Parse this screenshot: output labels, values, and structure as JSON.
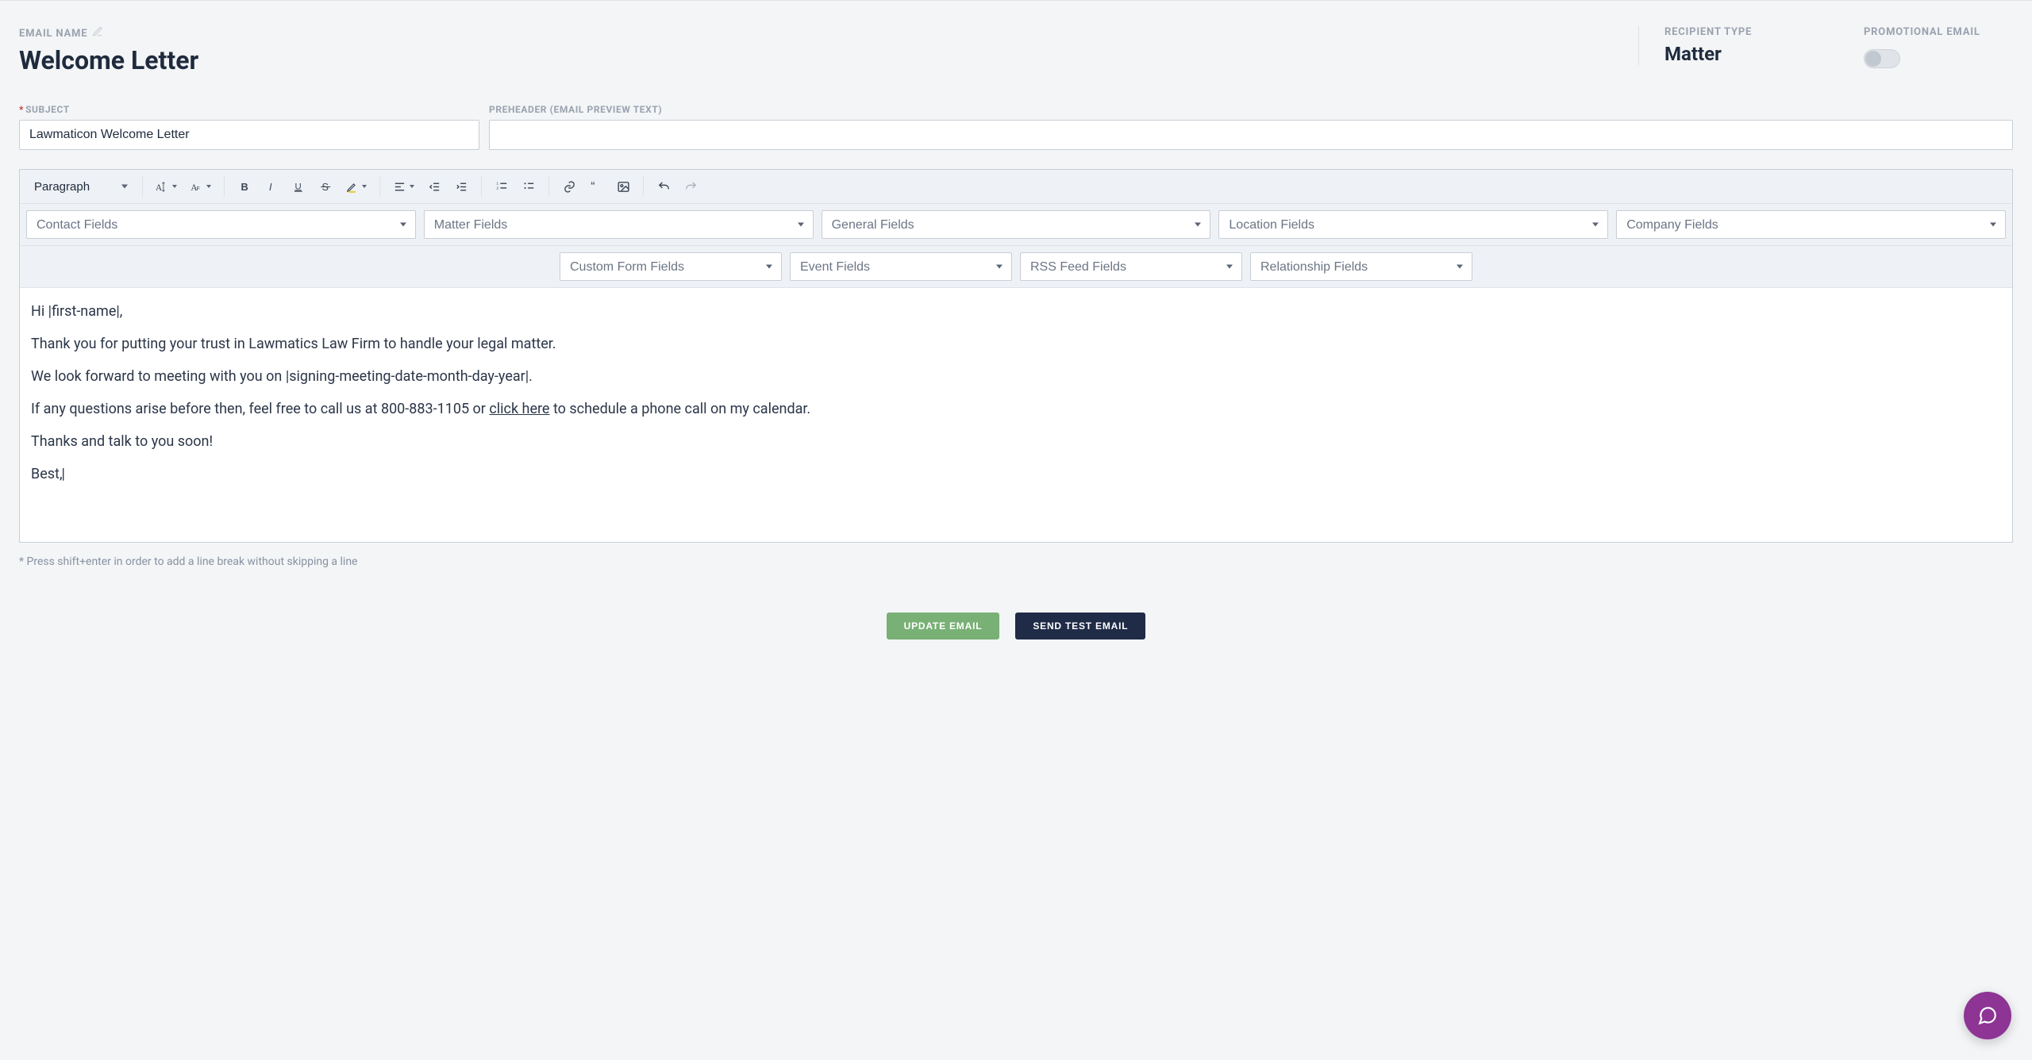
{
  "header": {
    "email_name_label": "EMAIL NAME",
    "title": "Welcome Letter",
    "recipient_type_label": "RECIPIENT TYPE",
    "recipient_type_value": "Matter",
    "promo_label": "PROMOTIONAL EMAIL",
    "promo_on": false
  },
  "form": {
    "subject_label": "SUBJECT",
    "subject_value": "Lawmaticon Welcome Letter",
    "preheader_label": "PREHEADER (EMAIL PREVIEW TEXT)",
    "preheader_value": ""
  },
  "toolbar": {
    "format_select": "Paragraph"
  },
  "merge_fields": {
    "row1": [
      "Contact Fields",
      "Matter Fields",
      "General Fields",
      "Location Fields",
      "Company Fields"
    ],
    "row2": [
      "Custom Form Fields",
      "Event Fields",
      "RSS Feed Fields",
      "Relationship Fields"
    ]
  },
  "body": {
    "p1": "Hi |first-name|,",
    "p2": "Thank you for putting your trust in Lawmatics Law Firm to handle your legal matter.",
    "p3": "We look forward to meeting with you on |signing-meeting-date-month-day-year|.",
    "p4_a": "If any questions arise before then, feel free to call us at 800-883-1105 or ",
    "p4_link": "click here",
    "p4_b": " to schedule a phone call on my calendar.",
    "p5": "Thanks and talk to you soon!",
    "p6": "Best,"
  },
  "hint": "* Press shift+enter in order to add a line break without skipping a line",
  "actions": {
    "update": "UPDATE EMAIL",
    "send_test": "SEND TEST EMAIL"
  }
}
